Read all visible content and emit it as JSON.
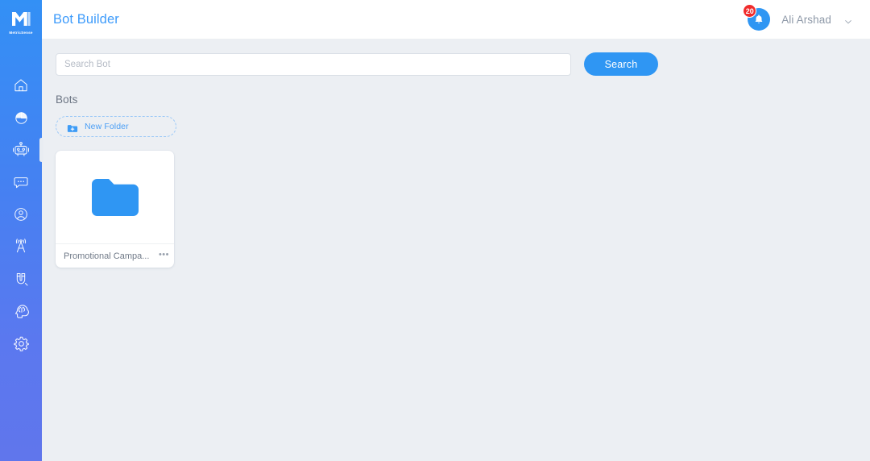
{
  "brand": {
    "name": "MetricSense",
    "logo_icon": "metricsense-m-logo"
  },
  "colors": {
    "accent_blue": "#2f96f3",
    "title_blue": "#3d9bfb",
    "sidebar_top": "#3390f5",
    "sidebar_bottom": "#6076ec",
    "badge_red": "#f02c2c",
    "content_bg": "#eceff3",
    "folder_blue": "#2f96f3"
  },
  "sidebar": {
    "items": [
      {
        "name": "home",
        "icon": "home-icon",
        "active": false
      },
      {
        "name": "analytics",
        "icon": "pie-chart-icon",
        "active": false
      },
      {
        "name": "bot-builder",
        "icon": "robot-icon",
        "active": true
      },
      {
        "name": "chat",
        "icon": "chat-bubble-icon",
        "active": false
      },
      {
        "name": "contacts",
        "icon": "user-circle-icon",
        "active": false
      },
      {
        "name": "broadcast",
        "icon": "antenna-icon",
        "active": false
      },
      {
        "name": "engage",
        "icon": "magnet-icon",
        "active": false
      },
      {
        "name": "ai-insights",
        "icon": "brain-head-icon",
        "active": false
      },
      {
        "name": "settings",
        "icon": "gear-icon",
        "active": false
      }
    ]
  },
  "header": {
    "title": "Bot Builder",
    "notifications": {
      "icon": "bell-icon",
      "count": "20"
    },
    "user": {
      "name": "Ali Arshad",
      "chevron_icon": "chevron-down-icon"
    }
  },
  "search": {
    "placeholder": "Search Bot",
    "value": "",
    "button_label": "Search"
  },
  "bots_section": {
    "heading": "Bots",
    "new_folder": {
      "label": "New Folder",
      "icon": "folder-plus-icon"
    },
    "folders": [
      {
        "name": "Promotional Campa...",
        "icon": "folder-icon",
        "menu_label": "•••"
      }
    ]
  }
}
